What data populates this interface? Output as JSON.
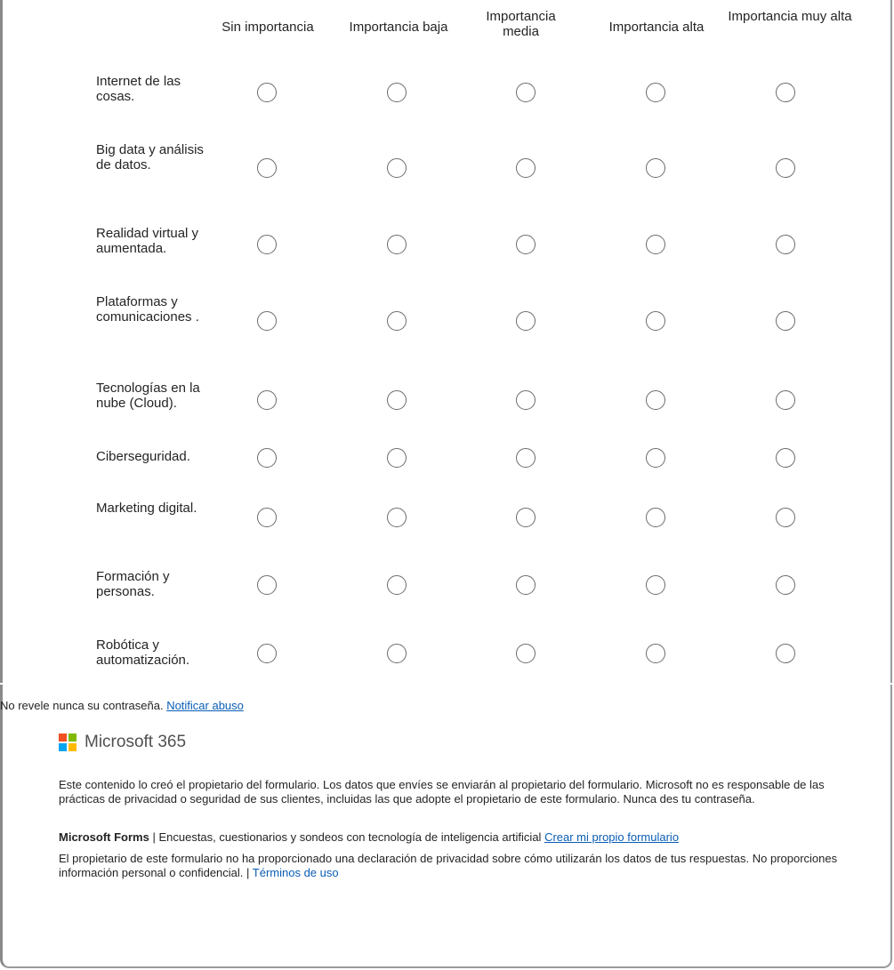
{
  "columns": [
    "Sin importancia",
    "Importancia baja",
    "Importancia media",
    "Importancia alta",
    "Importancia muy alta"
  ],
  "rows": [
    "Internet de las cosas.",
    "Big data y análisis de datos.",
    "Realidad virtual y aumentada.",
    "Plataformas y comunicaciones .",
    "Tecnologías en la nube (Cloud).",
    "Ciberseguridad.",
    "Marketing digital.",
    "Formación y personas.",
    "Robótica y automatización."
  ],
  "notice": {
    "text": "No revele nunca su contraseña.",
    "link": "Notificar abuso"
  },
  "footer": {
    "brand": "Microsoft 365",
    "brand_colors": [
      "#f25022",
      "#7fba00",
      "#00a4ef",
      "#ffb900"
    ],
    "disclaimer": "Este contenido lo creó el propietario del formulario. Los datos que envíes se enviarán al propietario del formulario. Microsoft no es responsable de las prácticas de privacidad o seguridad de sus clientes, incluidas las que adopte el propietario de este formulario. Nunca des tu contraseña.",
    "forms_name": "Microsoft Forms",
    "forms_tagline": "| Encuestas, cuestionarios y sondeos con tecnología de inteligencia artificial",
    "forms_link": "Crear mi propio formulario",
    "privacy_text": "El propietario de este formulario no ha proporcionado una declaración de privacidad sobre cómo utilizarán los datos de tus respuestas. No proporciones información personal o confidencial. |",
    "terms_link": "Términos de uso"
  }
}
